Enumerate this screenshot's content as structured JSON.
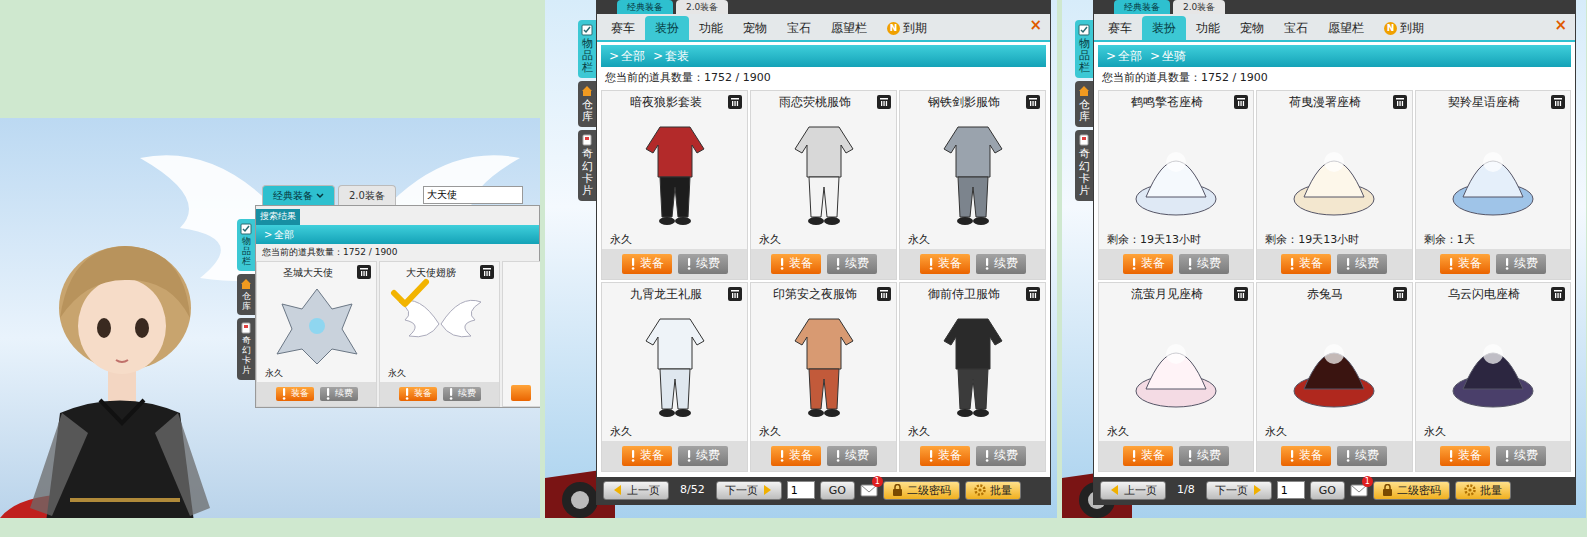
{
  "panel1": {
    "window": {
      "top_tabs": [
        {
          "label": "经典装备",
          "selected": true
        },
        {
          "label": "2.0装备",
          "selected": false
        }
      ],
      "search": {
        "value": "大天使"
      },
      "results_label": "搜索结果",
      "side_tabs": [
        {
          "label": "物品栏",
          "selected": true
        },
        {
          "label": "仓库",
          "selected": false
        },
        {
          "label": "奇幻卡片",
          "selected": false
        }
      ],
      "breadcrumb": [
        {
          "arrow": ">",
          "label": "全部"
        }
      ],
      "count": "您当前的道具数量：1752 / 1900",
      "items": [
        {
          "name": "圣城大天使",
          "equipped": false,
          "duration": "永久",
          "equip": "装备",
          "renew": "续费"
        },
        {
          "name": "大天使翅膀",
          "equipped": true,
          "duration": "永久",
          "equip": "装备",
          "renew": "续费"
        }
      ]
    }
  },
  "windows": [
    {
      "kind": "outfit",
      "top_tabs": [
        {
          "label": "经典装备",
          "selected": true
        },
        {
          "label": "2.0装备",
          "selected": false
        }
      ],
      "menu_tabs": [
        {
          "label": "赛车",
          "selected": false
        },
        {
          "label": "装扮",
          "selected": true
        },
        {
          "label": "功能",
          "selected": false
        },
        {
          "label": "宠物",
          "selected": false
        },
        {
          "label": "宝石",
          "selected": false
        },
        {
          "label": "愿望栏",
          "selected": false
        },
        {
          "label": "到期",
          "selected": false,
          "badge": "N"
        }
      ],
      "close": "×",
      "side_tabs": [
        {
          "label": "物品栏",
          "selected": true
        },
        {
          "label": "仓库",
          "selected": false
        },
        {
          "label": "奇幻卡片",
          "selected": false
        }
      ],
      "breadcrumb": [
        {
          "arrow": ">",
          "label": "全部"
        },
        {
          "arrow": ">",
          "label": "套装"
        }
      ],
      "count": "您当前的道具数量：1752 / 1900",
      "items": [
        {
          "name": "暗夜狼影套装",
          "duration": "永久",
          "equip": "装备",
          "renew": "续费"
        },
        {
          "name": "雨恋荧桃服饰",
          "duration": "永久",
          "equip": "装备",
          "renew": "续费"
        },
        {
          "name": "钢铁剑影服饰",
          "duration": "永久",
          "equip": "装备",
          "renew": "续费"
        },
        {
          "name": "九霄龙王礼服",
          "duration": "永久",
          "equip": "装备",
          "renew": "续费"
        },
        {
          "name": "印第安之夜服饰",
          "duration": "永久",
          "equip": "装备",
          "renew": "续费"
        },
        {
          "name": "御前侍卫服饰",
          "duration": "永久",
          "equip": "装备",
          "renew": "续费"
        }
      ],
      "pager": {
        "prev": "上一页",
        "page": "8/52",
        "next": "下一页",
        "input": "1",
        "go": "GO",
        "mail_badge": "1",
        "password": "二级密码",
        "batch": "批量"
      }
    },
    {
      "kind": "mount",
      "top_tabs": [
        {
          "label": "经典装备",
          "selected": true
        },
        {
          "label": "2.0装备",
          "selected": false
        }
      ],
      "menu_tabs": [
        {
          "label": "赛车",
          "selected": false
        },
        {
          "label": "装扮",
          "selected": true
        },
        {
          "label": "功能",
          "selected": false
        },
        {
          "label": "宠物",
          "selected": false
        },
        {
          "label": "宝石",
          "selected": false
        },
        {
          "label": "愿望栏",
          "selected": false
        },
        {
          "label": "到期",
          "selected": false,
          "badge": "N"
        }
      ],
      "close": "×",
      "side_tabs": [
        {
          "label": "物品栏",
          "selected": true
        },
        {
          "label": "仓库",
          "selected": false
        },
        {
          "label": "奇幻卡片",
          "selected": false
        }
      ],
      "breadcrumb": [
        {
          "arrow": ">",
          "label": "全部"
        },
        {
          "arrow": ">",
          "label": "坐骑"
        }
      ],
      "count": "您当前的道具数量：1752 / 1900",
      "items": [
        {
          "name": "鹤鸣擎苍座椅",
          "duration": "剩余：19天13小时",
          "equip": "装备",
          "renew": "续费"
        },
        {
          "name": "荷曳漫署座椅",
          "duration": "剩余：19天13小时",
          "equip": "装备",
          "renew": "续费"
        },
        {
          "name": "契羚星语座椅",
          "duration": "剩余：1天",
          "equip": "装备",
          "renew": "续费"
        },
        {
          "name": "流萤月见座椅",
          "duration": "永久",
          "equip": "装备",
          "renew": "续费"
        },
        {
          "name": "赤兔马",
          "duration": "永久",
          "equip": "装备",
          "renew": "续费"
        },
        {
          "name": "乌云闪电座椅",
          "duration": "永久",
          "equip": "装备",
          "renew": "续费"
        }
      ],
      "pager": {
        "prev": "上一页",
        "page": "1/8",
        "next": "下一页",
        "input": "1",
        "go": "GO",
        "mail_badge": "1",
        "password": "二级密码",
        "batch": "批量"
      }
    }
  ]
}
